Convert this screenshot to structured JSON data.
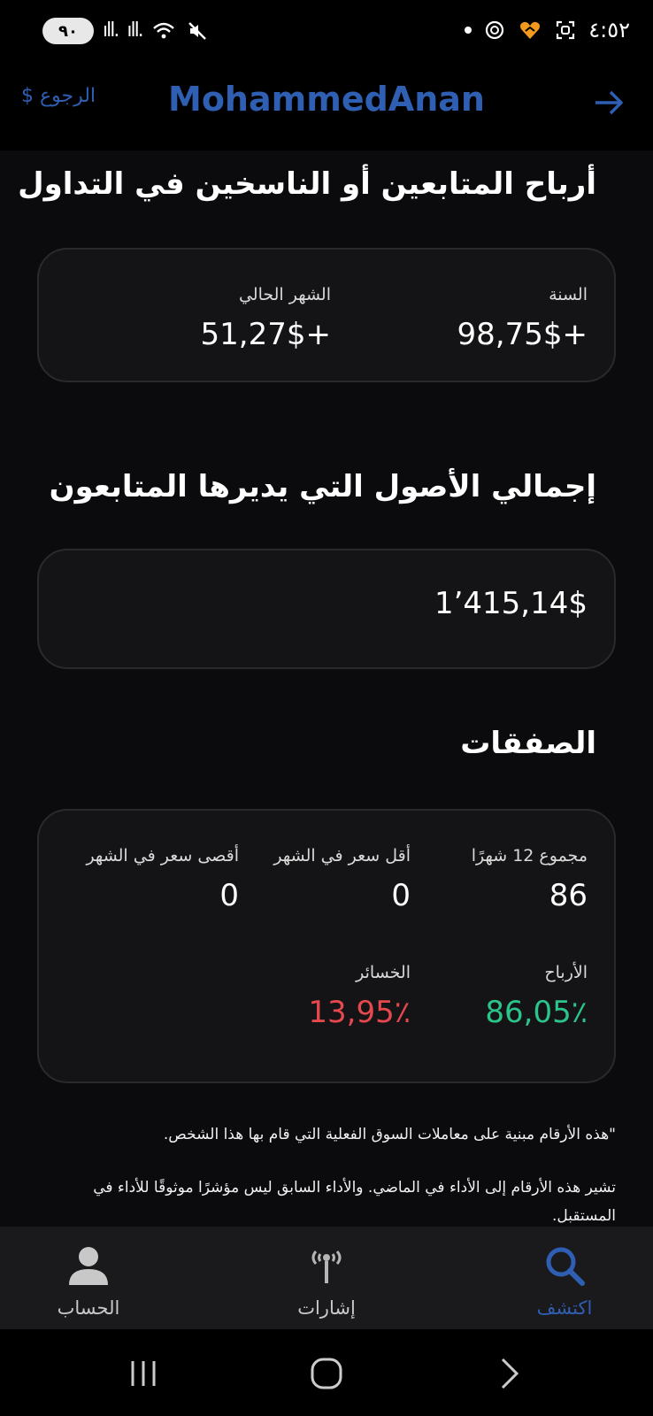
{
  "status_bar": {
    "battery": "٩٠",
    "time": "٤:٥٢"
  },
  "header": {
    "back_label": "الرجوع $",
    "title": "MohammedAnan"
  },
  "profits": {
    "title": "أرباح المتابعين أو الناسخين في التداول",
    "year_label": "السنة",
    "year_value": "+98,75$",
    "month_label": "الشهر الحالي",
    "month_value": "+51,27$"
  },
  "assets": {
    "title": "إجمالي الأصول التي يديرها المتابعون",
    "value": "1٬415,14$"
  },
  "trades": {
    "title": "الصفقات",
    "total_label": "مجموع 12 شهرًا",
    "total_value": "86",
    "min_label": "أقل سعر في الشهر",
    "min_value": "0",
    "max_label": "أقصى سعر في الشهر",
    "max_value": "0",
    "profit_label": "الأرباح",
    "profit_value": "86,05٪",
    "loss_label": "الخسائر",
    "loss_value": "13,95٪"
  },
  "disclaimer": {
    "line1": "\"هذه الأرقام مبنية على معاملات السوق الفعلية التي قام بها هذا الشخص.",
    "line2": "تشير هذه الأرقام إلى الأداء في الماضي. والأداء السابق ليس مؤشرًا موثوقًا للأداء في المستقبل."
  },
  "nav": {
    "explore": "اكتشف",
    "signals": "إشارات",
    "account": "الحساب"
  },
  "colors": {
    "accent": "#2f5fb3",
    "profit": "#2bc48a",
    "loss": "#e5484d"
  }
}
